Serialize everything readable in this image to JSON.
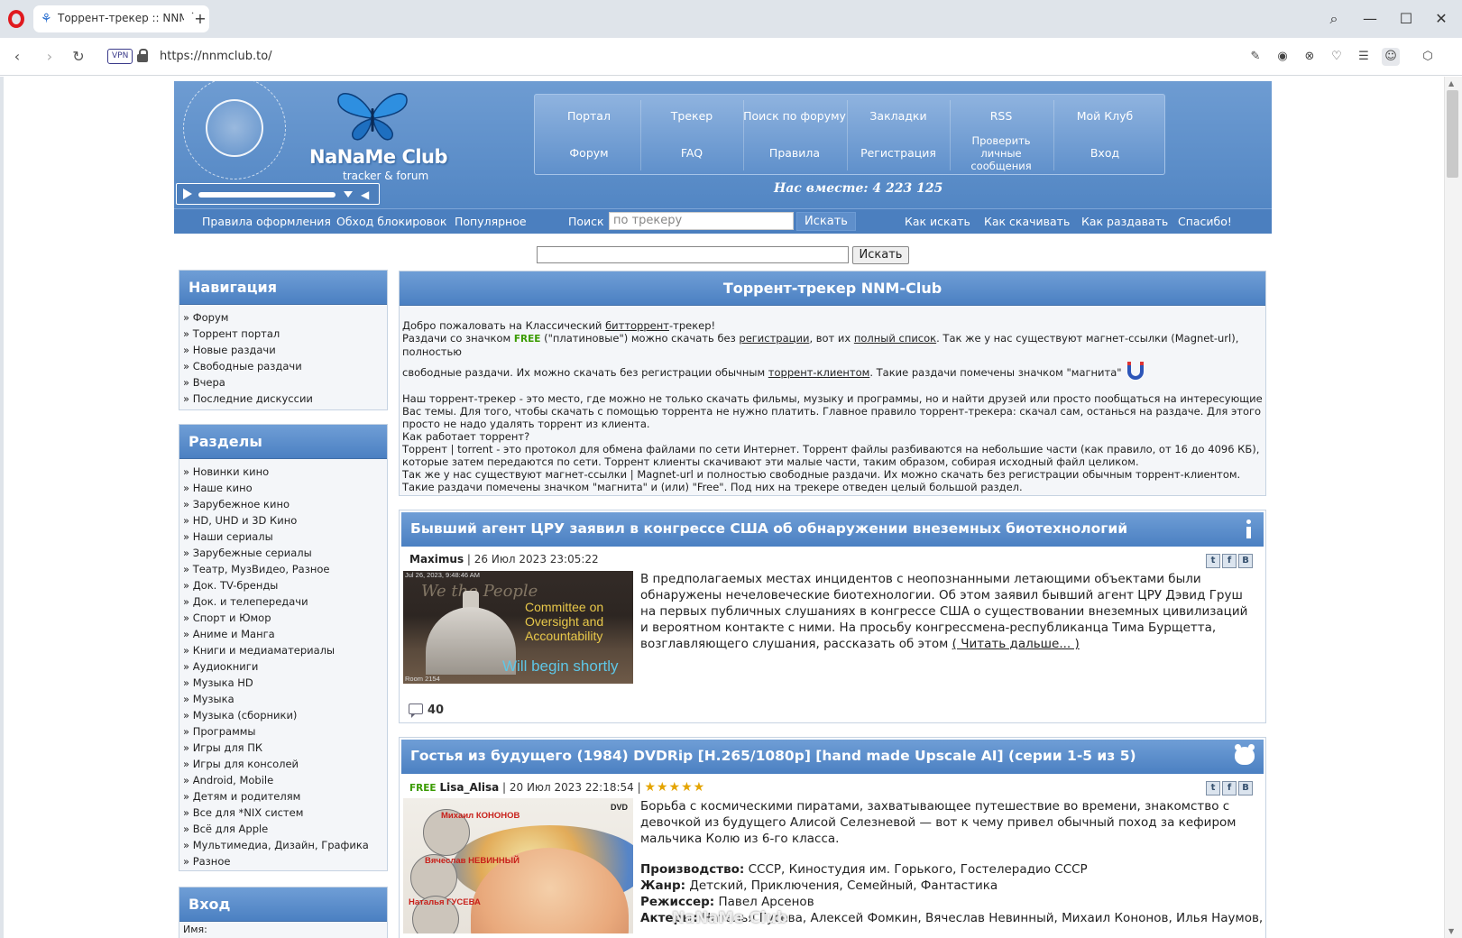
{
  "browser": {
    "tab_title": "Торрент-трекер :: NNM-Club",
    "url": "https://nnmclub.to/",
    "vpn_label": "VPN"
  },
  "header": {
    "logo_text": "NaNaMe Club",
    "logo_sub": "tracker & forum",
    "nav_top": [
      "Портал",
      "Трекер",
      "Поиск по форуму",
      "Закладки",
      "RSS",
      "Мой Клуб"
    ],
    "nav_bottom": [
      "Форум",
      "FAQ",
      "Правила",
      "Регистрация",
      "Проверить личные сообщения",
      "Вход"
    ],
    "together_label": "Нас вместе: 4 223 125"
  },
  "subnav": {
    "links": [
      "Правила оформления",
      "Обход блокировок",
      "Популярное"
    ],
    "search_label": "Поиск :",
    "search_placeholder": "по трекеру",
    "search_button": "Искать",
    "help_links": [
      "Как искать",
      "Как скачивать",
      "Как раздавать",
      "Спасибо!"
    ]
  },
  "site_search": {
    "button": "Искать"
  },
  "sidebar": {
    "nav_title": "Навигация",
    "nav_items": [
      "Форум",
      "Торрент портал",
      "Новые раздачи",
      "Свободные раздачи",
      "Вчера",
      "Последние дискуссии"
    ],
    "sections_title": "Разделы",
    "sections_items": [
      "Новинки кино",
      "Наше кино",
      "Зарубежное кино",
      "HD, UHD и 3D Кино",
      "Наши сериалы",
      "Зарубежные сериалы",
      "Театр, МузВидео, Разное",
      "Док. TV-бренды",
      "Док. и телепередачи",
      "Спорт и Юмор",
      "Аниме и Манга",
      "Книги и медиаматериалы",
      "Аудиокниги",
      "Музыка HD",
      "Музыка",
      "Музыка (сборники)",
      "Программы",
      "Игры для ПК",
      "Игры для консолей",
      "Android, Mobile",
      "Детям и родителям",
      "Все для *NIX систем",
      "Всё для Apple",
      "Мультимедиа, Дизайн, Графика",
      "Разное"
    ],
    "login_title": "Вход",
    "login_name_label": "Имя:"
  },
  "main": {
    "title": "Торрент-трекер NNM-Club",
    "intro": {
      "l1_a": "Добро пожаловать на Классический ",
      "l1_link": "битторрент",
      "l1_b": "-трекер!",
      "l2_a": "Раздачи со значком ",
      "free": "FREE",
      "l2_b": " (\"платиновые\") можно скачать без ",
      "l2_link1": "регистрации",
      "l2_c": ", вот их ",
      "l2_link2": "полный список",
      "l2_d": ". Так же у нас существуют магнет-ссылки (Magnet-url), полностью",
      "l3_a": "свободные раздачи. Их можно скачать без регистрации обычным ",
      "l3_link": "торрент-клиентом",
      "l3_b": ". Такие раздачи помечены значком \"магнита\"",
      "p2": "Наш торрент-трекер - это место, где можно не только скачать фильмы, музыку и программы, но и найти друзей или просто пообщаться на интересующие Вас темы. Для того, чтобы скачать с помощью торрента не нужно платить. Главное правило торрент-трекера: скачал сам, останься на раздаче. Для этого просто не надо удалять торрент из клиента.",
      "p3": "Как работает торрент?",
      "p4": "Торрент | torrent - это протокол для обмена файлами по сети Интернет. Торрент файлы разбиваются на небольшие части (как правило, от 16 до 4096 КБ), которые затем передаются по сети. Торрент клиенты скачивают эти малые части, таким образом, собирая исходный файл целиком.",
      "p5": "Так же у нас существуют магнет-ссылки | Magnet-url и полностью свободные раздачи. Их можно скачать без регистрации обычным торрент-клиентом. Такие раздачи помечены значком \"магнита\" и (или) \"Free\". Под них на трекере отведен целый большой раздел."
    }
  },
  "news": [
    {
      "title": "Бывший агент ЦРУ заявил в конгрессе США об обнаружении внеземных биотехнологий",
      "author": "Maximus",
      "date": " | 26 Июл 2023 23:05:22",
      "text": "В предполагаемых местах инцидентов с неопознанными летающими объектами были обнаружены нечеловеческие биотехнологии. Об этом заявил бывший агент ЦРУ Дэвид Груш на первых публичных слушаниях в конгрессе США о существовании внеземных цивилизаций и вероятном контакте с ними. На просьбу конгрессмена-республиканца Тима Бурщетта, возглавляющего слушания, рассказать об этом ",
      "read_more": "( Читать дальше... )",
      "comments": "40",
      "img_stamp": "Jul 26, 2023, 9:48:46 AM",
      "img_text": "Committee on Oversight and Accountability",
      "img_shortly": "Will begin shortly",
      "img_room": "Room 2154",
      "img_script": "We the People"
    },
    {
      "title": "Гостья из будущего (1984) DVDRip [H.265/1080p] [hand made Upscale AI] (серии 1-5 из 5)",
      "free": "FREE",
      "author": "Lisa_Alisa",
      "date": " | 20 Июл 2023 22:18:54 | ",
      "stars": "★★★★★",
      "rating": 5,
      "text": "Борьба с космическими пиратами, захватывающее путешествие во времени, знакомство с девочкой из будущего Алисой Селезневой — вот к чему привел обычный поход за кефиром мальчика Колю из 6-го класса.",
      "prod_label": "Производство:",
      "prod": " СССР, Киностудия им. Горького, Гостелерадио СССР",
      "genre_label": "Жанр:",
      "genre": " Детский, Приключения, Семейный, Фантастика",
      "director_label": "Режиссер:",
      "director": " Павел Арсенов",
      "actors_label": "Актеры:",
      "actors": " Наталья Гусева, Алексей Фомкин, Вячеслав Невинный, Михаил Кононов, Илья Наумов,",
      "poster_names": [
        "Михаил КОНОНОВ",
        "Вячеслав НЕВИННЫЙ",
        "Наталья ГУСЕВА"
      ],
      "dvd": "DVD"
    }
  ],
  "share_icons": [
    "t",
    "f",
    "В"
  ],
  "watermark": "NaNaMe Club"
}
